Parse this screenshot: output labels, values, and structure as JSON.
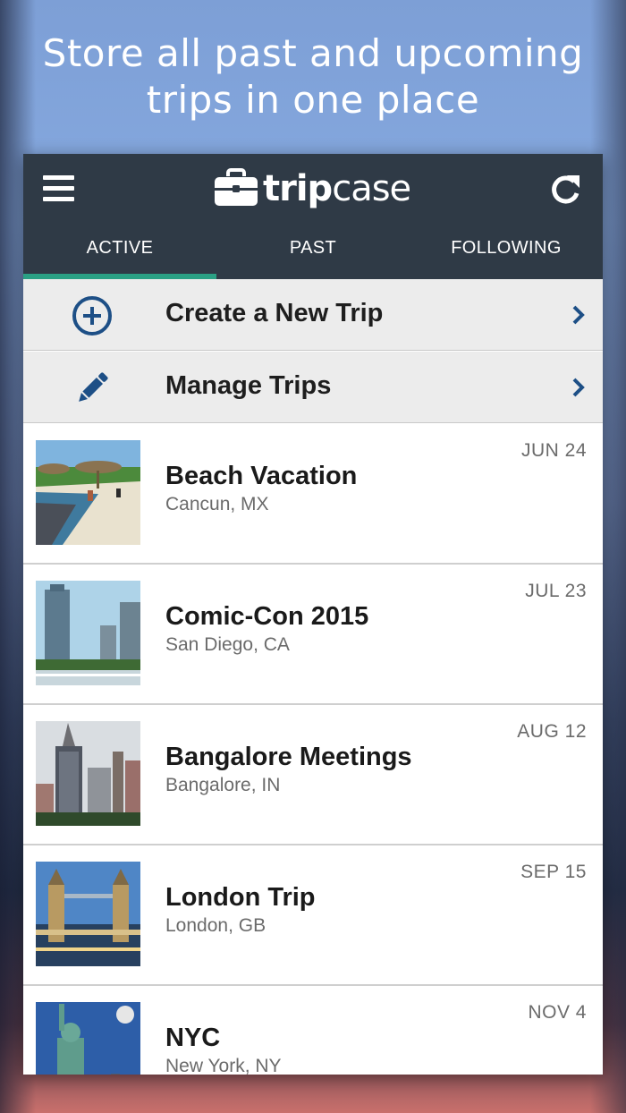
{
  "headline": {
    "line1": "Store all past and upcoming",
    "line2": "trips in one place"
  },
  "app": {
    "logo_text_bold": "trip",
    "logo_text_light": "case"
  },
  "tabs": [
    {
      "label": "ACTIVE",
      "active": true
    },
    {
      "label": "PAST",
      "active": false
    },
    {
      "label": "FOLLOWING",
      "active": false
    }
  ],
  "actions": [
    {
      "label": "Create a New Trip",
      "icon": "plus-circle-icon"
    },
    {
      "label": "Manage Trips",
      "icon": "pencil-icon"
    }
  ],
  "trips": [
    {
      "title": "Beach Vacation",
      "location": "Cancun, MX",
      "date": "JUN 24",
      "image": "beach-photo"
    },
    {
      "title": "Comic-Con 2015",
      "location": "San Diego, CA",
      "date": "JUL 23",
      "image": "san-diego-skyline-photo"
    },
    {
      "title": "Bangalore Meetings",
      "location": "Bangalore, IN",
      "date": "AUG 12",
      "image": "bangalore-towers-photo"
    },
    {
      "title": "London Trip",
      "location": "London, GB",
      "date": "SEP 15",
      "image": "tower-bridge-photo"
    },
    {
      "title": "NYC",
      "location": "New York, NY",
      "date": "NOV 4",
      "image": "statue-of-liberty-photo"
    }
  ],
  "colors": {
    "topbar": "#2f3a46",
    "tab_indicator": "#2aa084",
    "action_icon": "#1d4f86",
    "action_row_bg": "#ececec"
  }
}
